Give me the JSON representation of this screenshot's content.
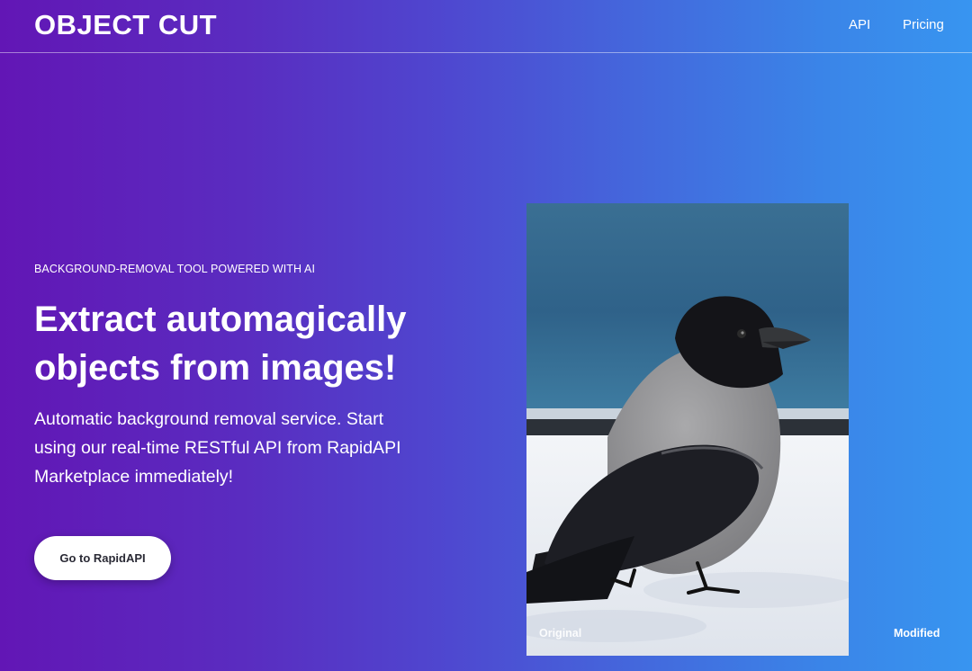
{
  "brand": {
    "name": "OBJECT CUT"
  },
  "nav": {
    "items": [
      {
        "label": "API"
      },
      {
        "label": "Pricing"
      }
    ]
  },
  "hero": {
    "eyebrow": "BACKGROUND-REMOVAL TOOL POWERED WITH AI",
    "headline": "Extract automagically objects from images!",
    "description": "Automatic background removal service. Start using our real-time RESTful API from RapidAPI Marketplace immediately!",
    "cta_label": "Go to RapidAPI"
  },
  "comparison": {
    "original_label": "Original",
    "modified_label": "Modified",
    "image_subject": "hooded-crow-photo"
  },
  "colors": {
    "gradient_start": "#6216b5",
    "gradient_end": "#3895f0",
    "button_bg": "#ffffff",
    "button_text": "#2a2a35"
  }
}
